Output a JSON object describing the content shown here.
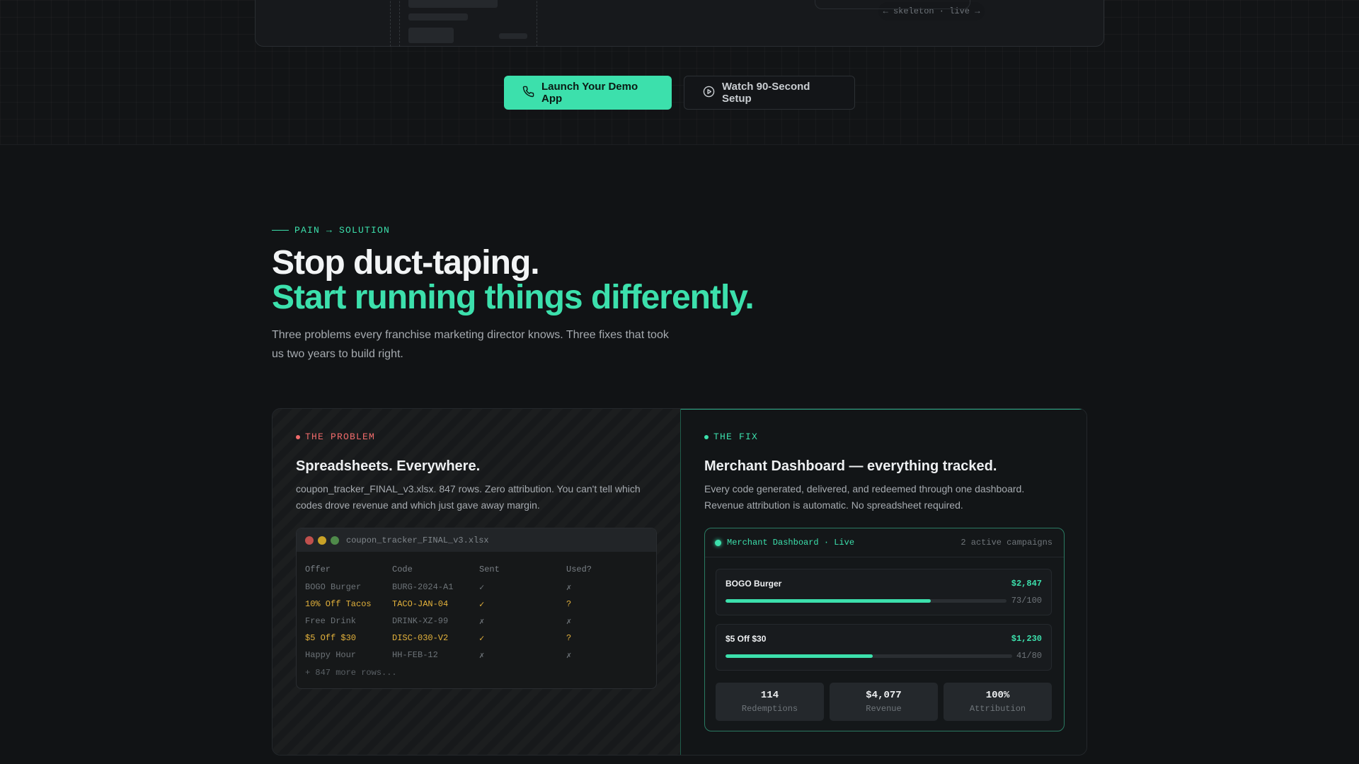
{
  "preview": {
    "skeleton_label": "← skeleton · live →"
  },
  "cta": {
    "primary_label": "Launch Your Demo App",
    "secondary_label": "Watch 90-Second Setup"
  },
  "section": {
    "eyebrow": "PAIN → SOLUTION",
    "headline_line1": "Stop duct-taping.",
    "headline_line2": "Start running things differently.",
    "lede": "Three problems every franchise marketing director knows. Three fixes that took us two years to build right."
  },
  "problem": {
    "tag": "THE PROBLEM",
    "title": "Spreadsheets. Everywhere.",
    "description": "coupon_tracker_FINAL_v3.xlsx. 847 rows. Zero attribution. You can't tell which codes drove revenue and which just gave away margin.",
    "sheet": {
      "filename": "coupon_tracker_FINAL_v3.xlsx",
      "headers": [
        "Offer",
        "Code",
        "Sent",
        "Used?"
      ],
      "rows": [
        {
          "cells": [
            "BOGO Burger",
            "BURG-2024-A1",
            "✓",
            "✗"
          ],
          "highlight": false
        },
        {
          "cells": [
            "10% Off Tacos",
            "TACO-JAN-04",
            "✓",
            "?"
          ],
          "highlight": true
        },
        {
          "cells": [
            "Free Drink",
            "DRINK-XZ-99",
            "✗",
            "✗"
          ],
          "highlight": false
        },
        {
          "cells": [
            "$5 Off $30",
            "DISC-030-V2",
            "✓",
            "?"
          ],
          "highlight": true
        },
        {
          "cells": [
            "Happy Hour",
            "HH-FEB-12",
            "✗",
            "✗"
          ],
          "highlight": false
        }
      ],
      "more": "+ 847 more rows..."
    }
  },
  "fix": {
    "tag": "THE FIX",
    "title": "Merchant Dashboard — everything tracked.",
    "description": "Every code generated, delivered, and redeemed through one dashboard. Revenue attribution is automatic. No spreadsheet required.",
    "dashboard": {
      "header_title": "Merchant Dashboard · Live",
      "campaign_count": "2 active campaigns",
      "campaigns": [
        {
          "name": "BOGO Burger",
          "revenue": "$2,847",
          "ratio": "73/100",
          "progress": 0.73
        },
        {
          "name": "$5 Off $30",
          "revenue": "$1,230",
          "ratio": "41/80",
          "progress": 0.5125
        }
      ],
      "stats": [
        {
          "value": "114",
          "label": "Redemptions"
        },
        {
          "value": "$4,077",
          "label": "Revenue"
        },
        {
          "value": "100%",
          "label": "Attribution"
        }
      ]
    }
  },
  "colors": {
    "accent": "#3ce0ac",
    "problem": "#f06b6b",
    "warning": "#e5b33c",
    "background": "#111315"
  },
  "icons": {
    "primary_button": "phone-icon",
    "secondary_button": "play-circle-icon"
  }
}
